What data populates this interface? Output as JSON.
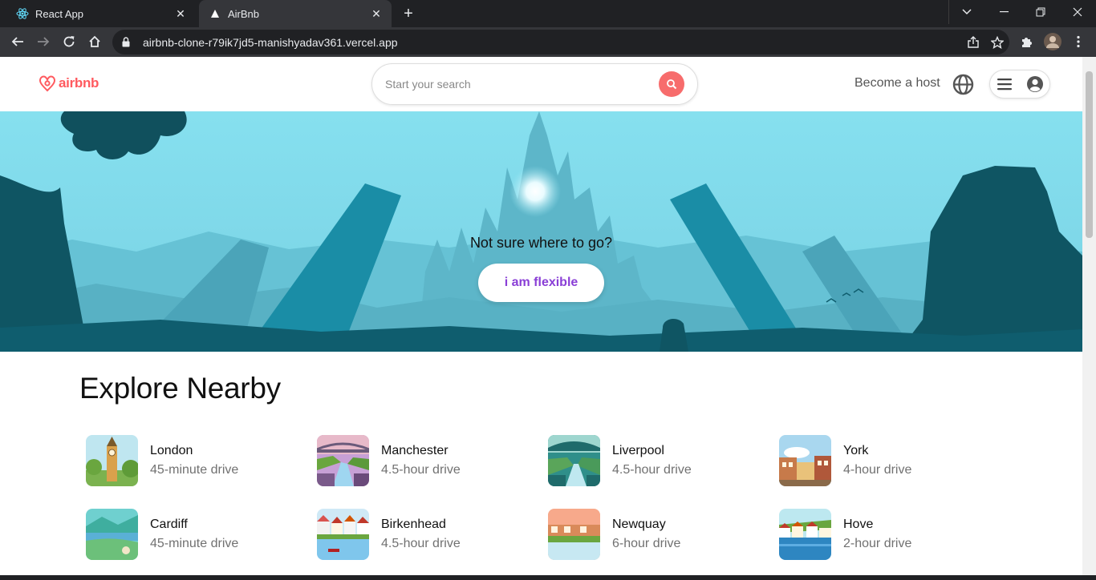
{
  "browser": {
    "tabs": [
      {
        "title": "React App",
        "icon": "react-icon",
        "active": false
      },
      {
        "title": "AirBnb",
        "icon": "vercel-triangle-icon",
        "active": true
      }
    ],
    "url": "airbnb-clone-r79ik7jd5-manishyadav361.vercel.app"
  },
  "header": {
    "logo_text": "airbnb",
    "search_placeholder": "Start your search",
    "become_host": "Become a host"
  },
  "hero": {
    "tagline": "Not sure where to go?",
    "cta_label": "i am flexible"
  },
  "explore": {
    "title": "Explore Nearby",
    "items": [
      {
        "name": "London",
        "distance": "45-minute drive",
        "thumb": "london-bigben"
      },
      {
        "name": "Manchester",
        "distance": "4.5-hour drive",
        "thumb": "manchester-bridge"
      },
      {
        "name": "Liverpool",
        "distance": "4.5-hour drive",
        "thumb": "liverpool-canal"
      },
      {
        "name": "York",
        "distance": "4-hour drive",
        "thumb": "york-town"
      },
      {
        "name": "Cardiff",
        "distance": "45-minute drive",
        "thumb": "cardiff-hills"
      },
      {
        "name": "Birkenhead",
        "distance": "4.5-hour drive",
        "thumb": "birkenhead-harbour"
      },
      {
        "name": "Newquay",
        "distance": "6-hour drive",
        "thumb": "newquay-coast"
      },
      {
        "name": "Hove",
        "distance": "2-hour drive",
        "thumb": "hove-seaside"
      }
    ]
  },
  "colors": {
    "brand": "#ff5a5f",
    "search_button": "#f76c6c",
    "cta_text": "#8a3fd6",
    "hero_sky": "#7fdcec",
    "hero_dark": "#0f5d6e"
  }
}
